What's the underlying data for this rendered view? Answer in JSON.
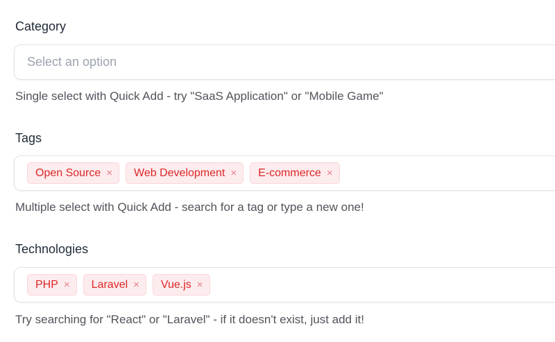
{
  "category": {
    "label": "Category",
    "placeholder": "Select an option",
    "help": "Single select with Quick Add - try \"SaaS Application\" or \"Mobile Game\""
  },
  "tags": {
    "label": "Tags",
    "selected": [
      "Open Source",
      "Web Development",
      "E-commerce"
    ],
    "help": "Multiple select with Quick Add - search for a tag or type a new one!"
  },
  "technologies": {
    "label": "Technologies",
    "selected": [
      "PHP",
      "Laravel",
      "Vue.js"
    ],
    "help": "Try searching for \"React\" or \"Laravel\" - if it doesn't exist, just add it!"
  },
  "remove_symbol": "×",
  "colors": {
    "chip_text": "#dc2626",
    "chip_bg": "#fdecee"
  }
}
